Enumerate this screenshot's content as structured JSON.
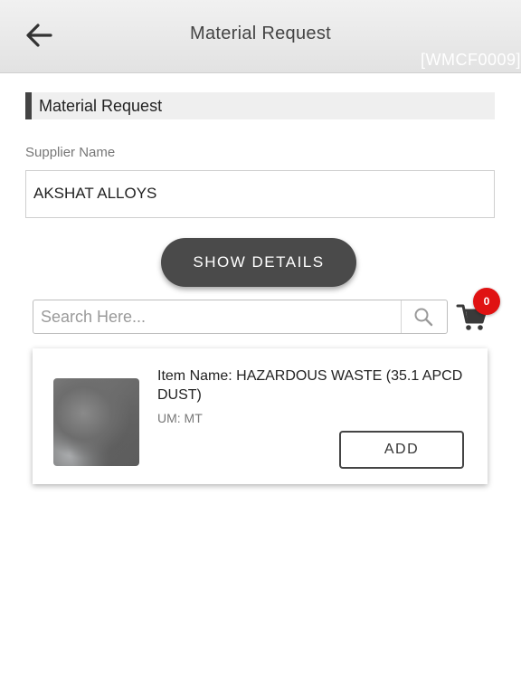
{
  "header": {
    "title": "Material Request",
    "screen_code": "[WMCF0009]",
    "back_icon": "arrow-left-icon"
  },
  "section": {
    "title": "Material Request",
    "accent_color": "#444444"
  },
  "supplier": {
    "label": "Supplier Name",
    "value": "AKSHAT ALLOYS"
  },
  "show_details": {
    "label": "SHOW DETAILS"
  },
  "search": {
    "placeholder": "Search Here...",
    "value": "",
    "icon": "search-icon"
  },
  "cart": {
    "icon": "shopping-cart-icon",
    "count": "0",
    "badge_color": "#e01212"
  },
  "items": [
    {
      "name": "Item Name: HAZARDOUS WASTE (35.1 APCD DUST)",
      "um": "UM: MT",
      "add_label": "ADD"
    }
  ]
}
